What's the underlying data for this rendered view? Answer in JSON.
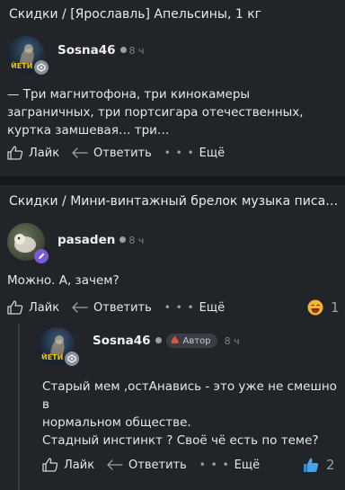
{
  "posts": [
    {
      "category": "Скидки /",
      "title": "[Ярославль] Апельсины, 1 кг",
      "author": "Sosna46",
      "time": "8 ч",
      "text": "— Три магнитофона, три кинокамеры заграничных, три портсигара отечественных, куртка замшевая… три…",
      "actions": {
        "like": "Лайк",
        "reply": "Ответить",
        "more": "Ещё"
      }
    },
    {
      "category": "Скидки /",
      "title": "Мини-винтажный брелок  музыка писать…",
      "author": "pasaden",
      "time": "8 ч",
      "text": "Можно. А, зачем?",
      "actions": {
        "like": "Лайк",
        "reply": "Ответить",
        "more": "Ещё"
      },
      "reaction_count": "1",
      "reply": {
        "author": "Sosna46",
        "author_tag": "Автор",
        "time": "8 ч",
        "text_lines": [
          "Старый мем ,остАнавись - это уже не смешно в",
          "нормальном обществе.",
          "Стадный инстинкт ? Своё чё есть по теме?"
        ],
        "actions": {
          "like": "Лайк",
          "reply": "Ответить",
          "more": "Ещё"
        },
        "reaction_count": "2"
      }
    }
  ],
  "avatar_label": "ЙЕТИ",
  "colors": {
    "background": "#212429",
    "separator": "#16181b",
    "text": "#e6e7e9",
    "muted": "#7e8389",
    "badge_gray": "#8a9099",
    "badge_purple": "#7a5ad6"
  },
  "icons": [
    "like-icon",
    "reply-icon",
    "more-icon",
    "laugh-emoji-icon",
    "thumbs-up-icon",
    "fire-icon"
  ]
}
